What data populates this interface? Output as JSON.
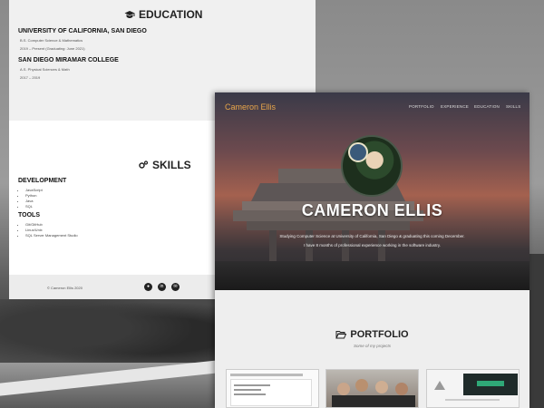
{
  "education": {
    "title": "EDUCATION",
    "schools": [
      {
        "name": "UNIVERSITY OF CALIFORNIA, SAN DIEGO",
        "degree": "B.S. Computer Science & Mathematics",
        "dates": "2019 – Present (Graduating: June 2021)"
      },
      {
        "name": "SAN DIEGO MIRAMAR COLLEGE",
        "degree": "A.S. Physical Sciences & Math",
        "dates": "2017 – 2019"
      }
    ]
  },
  "skills": {
    "title": "SKILLS",
    "categories": [
      {
        "name": "DEVELOPMENT",
        "items": [
          "JavaScript",
          "Python",
          "Java",
          "SQL"
        ]
      },
      {
        "name": "TOOLS",
        "items": [
          "Git/GitHub",
          "Linux/Unix",
          "SQL Server Management Studio"
        ]
      }
    ]
  },
  "footer": {
    "copyright": "© Cameron Ellis 2020",
    "social": [
      "github-icon",
      "linkedin-icon",
      "email-icon"
    ]
  },
  "hero": {
    "brand": "Cameron Ellis",
    "nav": [
      "PORTFOLIO",
      "EXPERIENCE",
      "EDUCATION",
      "SKILLS"
    ],
    "name": "CAMERON ELLIS",
    "tagline_1": "Studying Computer Science at University of California, San Diego & graduating this coming December.",
    "tagline_2": "I have 8 months of professional experience working in the software industry."
  },
  "portfolio": {
    "title": "PORTFOLIO",
    "subtitle": "Some of my projects"
  },
  "colors": {
    "brand": "#e8a64a",
    "dark": "#222222"
  }
}
